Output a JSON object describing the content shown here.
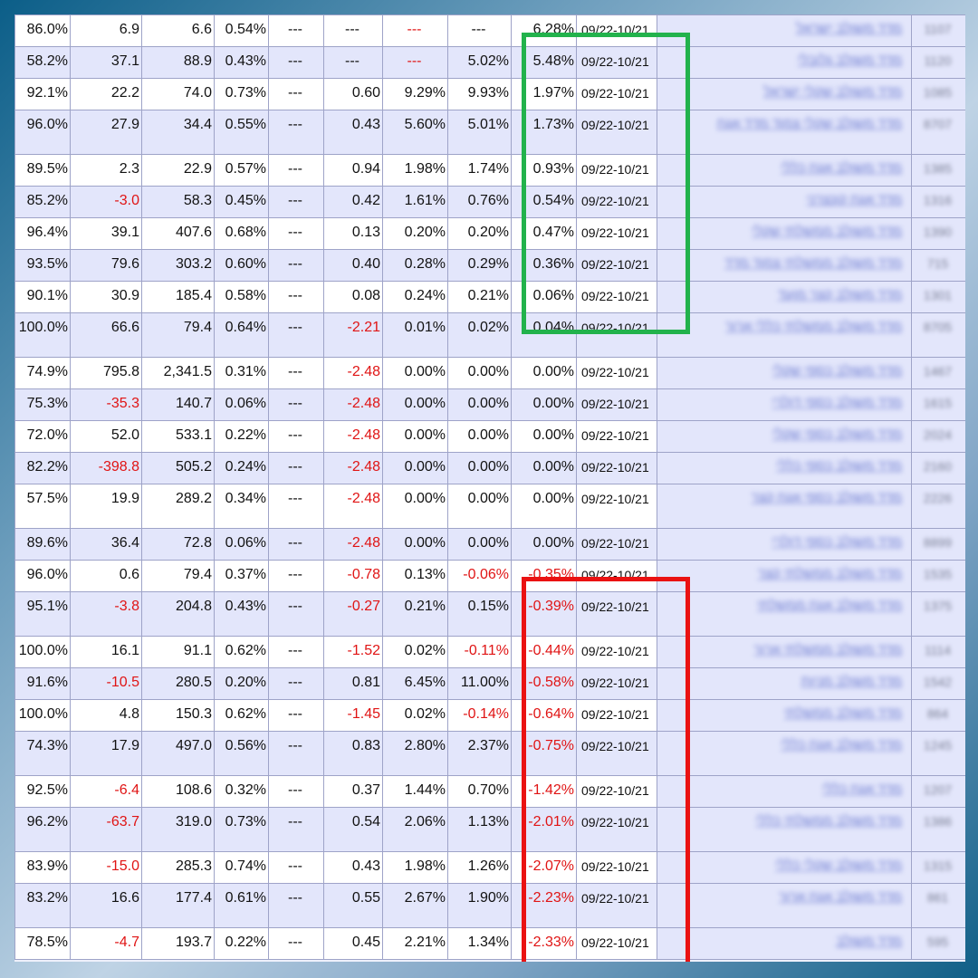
{
  "table": {
    "rows": [
      {
        "pct": "86.0%",
        "col2": "6.9",
        "col3": "6.6",
        "col4": "0.54%",
        "col5": "---",
        "col6": "---",
        "col7": "---",
        "col8": "---",
        "col9": "6.28%",
        "date": "09/22-10/21",
        "name": "מדד משולב ישראל",
        "id": "1107",
        "tall": false
      },
      {
        "pct": "58.2%",
        "col2": "37.1",
        "col3": "88.9",
        "col4": "0.43%",
        "col5": "---",
        "col6": "---",
        "col7": "---",
        "col8": "5.02%",
        "col9": "5.48%",
        "date": "09/22-10/21",
        "name": "מדד משולב גלובלי",
        "id": "1120",
        "tall": false
      },
      {
        "pct": "92.1%",
        "col2": "22.2",
        "col3": "74.0",
        "col4": "0.73%",
        "col5": "---",
        "col6": "0.60",
        "col7": "9.29%",
        "col8": "9.93%",
        "col9": "1.97%",
        "date": "09/22-10/21",
        "name": "מדד משולב שקלי ישראל",
        "id": "1085",
        "tall": false
      },
      {
        "pct": "96.0%",
        "col2": "27.9",
        "col3": "34.4",
        "col4": "0.55%",
        "col5": "---",
        "col6": "0.43",
        "col7": "5.60%",
        "col8": "5.01%",
        "col9": "1.73%",
        "date": "09/22-10/21",
        "name": "מדד משולב שקלי צמוד מדד אגח",
        "id": "8707",
        "tall": true
      },
      {
        "pct": "89.5%",
        "col2": "2.3",
        "col3": "22.9",
        "col4": "0.57%",
        "col5": "---",
        "col6": "0.94",
        "col7": "1.98%",
        "col8": "1.74%",
        "col9": "0.93%",
        "date": "09/22-10/21",
        "name": "מדד משולב אגח כללי",
        "id": "1385",
        "tall": false
      },
      {
        "pct": "85.2%",
        "col2": "-3.0",
        "col3": "58.3",
        "col4": "0.45%",
        "col5": "---",
        "col6": "0.42",
        "col7": "1.61%",
        "col8": "0.76%",
        "col9": "0.54%",
        "date": "09/22-10/21",
        "name": "מדד אגח קונצרני",
        "id": "1316",
        "tall": false
      },
      {
        "pct": "96.4%",
        "col2": "39.1",
        "col3": "407.6",
        "col4": "0.68%",
        "col5": "---",
        "col6": "0.13",
        "col7": "0.20%",
        "col8": "0.20%",
        "col9": "0.47%",
        "date": "09/22-10/21",
        "name": "מדד משולב ממשלתי שקלי",
        "id": "1390",
        "tall": false
      },
      {
        "pct": "93.5%",
        "col2": "79.6",
        "col3": "303.2",
        "col4": "0.60%",
        "col5": "---",
        "col6": "0.40",
        "col7": "0.28%",
        "col8": "0.29%",
        "col9": "0.36%",
        "date": "09/22-10/21",
        "name": "מדד משולב ממשלתי צמוד מדד",
        "id": "715",
        "tall": false
      },
      {
        "pct": "90.1%",
        "col2": "30.9",
        "col3": "185.4",
        "col4": "0.58%",
        "col5": "---",
        "col6": "0.08",
        "col7": "0.24%",
        "col8": "0.21%",
        "col9": "0.06%",
        "date": "09/22-10/21",
        "name": "מדד משולב קצר מועד",
        "id": "1301",
        "tall": false
      },
      {
        "pct": "100.0%",
        "col2": "66.6",
        "col3": "79.4",
        "col4": "0.64%",
        "col5": "---",
        "col6": "-2.21",
        "col7": "0.01%",
        "col8": "0.02%",
        "col9": "0.04%",
        "date": "09/22-10/21",
        "name": "מדד משולב ממשלתי כללי ארוך",
        "id": "8705",
        "tall": true
      },
      {
        "pct": "74.9%",
        "col2": "795.8",
        "col3": "2,341.5",
        "col4": "0.31%",
        "col5": "---",
        "col6": "-2.48",
        "col7": "0.00%",
        "col8": "0.00%",
        "col9": "0.00%",
        "date": "09/22-10/21",
        "name": "מדד משולב כספי שקלי",
        "id": "1467",
        "tall": false
      },
      {
        "pct": "75.3%",
        "col2": "-35.3",
        "col3": "140.7",
        "col4": "0.06%",
        "col5": "---",
        "col6": "-2.48",
        "col7": "0.00%",
        "col8": "0.00%",
        "col9": "0.00%",
        "date": "09/22-10/21",
        "name": "מדד משולב כספי דולרי",
        "id": "1615",
        "tall": false
      },
      {
        "pct": "72.0%",
        "col2": "52.0",
        "col3": "533.1",
        "col4": "0.22%",
        "col5": "---",
        "col6": "-2.48",
        "col7": "0.00%",
        "col8": "0.00%",
        "col9": "0.00%",
        "date": "09/22-10/21",
        "name": "מדד משולב כספי שקלי",
        "id": "2024",
        "tall": false
      },
      {
        "pct": "82.2%",
        "col2": "-398.8",
        "col3": "505.2",
        "col4": "0.24%",
        "col5": "---",
        "col6": "-2.48",
        "col7": "0.00%",
        "col8": "0.00%",
        "col9": "0.00%",
        "date": "09/22-10/21",
        "name": "מדד משולב כספי כללי",
        "id": "2160",
        "tall": false
      },
      {
        "pct": "57.5%",
        "col2": "19.9",
        "col3": "289.2",
        "col4": "0.34%",
        "col5": "---",
        "col6": "-2.48",
        "col7": "0.00%",
        "col8": "0.00%",
        "col9": "0.00%",
        "date": "09/22-10/21",
        "name": "מדד משולב כספי אגח קצר",
        "id": "2226",
        "tall": true
      },
      {
        "pct": "89.6%",
        "col2": "36.4",
        "col3": "72.8",
        "col4": "0.06%",
        "col5": "---",
        "col6": "-2.48",
        "col7": "0.00%",
        "col8": "0.00%",
        "col9": "0.00%",
        "date": "09/22-10/21",
        "name": "מדד משולב כספי דולרי",
        "id": "8899",
        "tall": false
      },
      {
        "pct": "96.0%",
        "col2": "0.6",
        "col3": "79.4",
        "col4": "0.37%",
        "col5": "---",
        "col6": "-0.78",
        "col7": "0.13%",
        "col8": "-0.06%",
        "col9": "-0.35%",
        "date": "09/22-10/21",
        "name": "מדד משולב ממשלתי קצר",
        "id": "1535",
        "tall": false
      },
      {
        "pct": "95.1%",
        "col2": "-3.8",
        "col3": "204.8",
        "col4": "0.43%",
        "col5": "---",
        "col6": "-0.27",
        "col7": "0.21%",
        "col8": "0.15%",
        "col9": "-0.39%",
        "date": "09/22-10/21",
        "name": "מדד משולב אגח ממשלתי",
        "id": "1375",
        "tall": true
      },
      {
        "pct": "100.0%",
        "col2": "16.1",
        "col3": "91.1",
        "col4": "0.62%",
        "col5": "---",
        "col6": "-1.52",
        "col7": "0.02%",
        "col8": "-0.11%",
        "col9": "-0.44%",
        "date": "09/22-10/21",
        "name": "מדד משולב ממשלתי ארוך",
        "id": "1114",
        "tall": false
      },
      {
        "pct": "91.6%",
        "col2": "-10.5",
        "col3": "280.5",
        "col4": "0.20%",
        "col5": "---",
        "col6": "0.81",
        "col7": "6.45%",
        "col8": "11.00%",
        "col9": "-0.58%",
        "date": "09/22-10/21",
        "name": "מדד משולב מניות",
        "id": "1542",
        "tall": false
      },
      {
        "pct": "100.0%",
        "col2": "4.8",
        "col3": "150.3",
        "col4": "0.62%",
        "col5": "---",
        "col6": "-1.45",
        "col7": "0.02%",
        "col8": "-0.14%",
        "col9": "-0.64%",
        "date": "09/22-10/21",
        "name": "מדד משולב ממשלתי",
        "id": "864",
        "tall": false
      },
      {
        "pct": "74.3%",
        "col2": "17.9",
        "col3": "497.0",
        "col4": "0.56%",
        "col5": "---",
        "col6": "0.83",
        "col7": "2.80%",
        "col8": "2.37%",
        "col9": "-0.75%",
        "date": "09/22-10/21",
        "name": "מדד משולב אגח כללי",
        "id": "1245",
        "tall": true
      },
      {
        "pct": "92.5%",
        "col2": "-6.4",
        "col3": "108.6",
        "col4": "0.32%",
        "col5": "---",
        "col6": "0.37",
        "col7": "1.44%",
        "col8": "0.70%",
        "col9": "-1.42%",
        "date": "09/22-10/21",
        "name": "מדד אגח כללי",
        "id": "1207",
        "tall": false
      },
      {
        "pct": "96.2%",
        "col2": "-63.7",
        "col3": "319.0",
        "col4": "0.73%",
        "col5": "---",
        "col6": "0.54",
        "col7": "2.06%",
        "col8": "1.13%",
        "col9": "-2.01%",
        "date": "09/22-10/21",
        "name": "מדד משולב ממשלתי כללי",
        "id": "1386",
        "tall": true
      },
      {
        "pct": "83.9%",
        "col2": "-15.0",
        "col3": "285.3",
        "col4": "0.74%",
        "col5": "---",
        "col6": "0.43",
        "col7": "1.98%",
        "col8": "1.26%",
        "col9": "-2.07%",
        "date": "09/22-10/21",
        "name": "מדד משולב שקלי כללי",
        "id": "1315",
        "tall": false
      },
      {
        "pct": "83.2%",
        "col2": "16.6",
        "col3": "177.4",
        "col4": "0.61%",
        "col5": "---",
        "col6": "0.55",
        "col7": "2.67%",
        "col8": "1.90%",
        "col9": "-2.23%",
        "date": "09/22-10/21",
        "name": "מדד משולב אגח ארוך",
        "id": "861",
        "tall": true
      },
      {
        "pct": "78.5%",
        "col2": "-4.7",
        "col3": "193.7",
        "col4": "0.22%",
        "col5": "---",
        "col6": "0.45",
        "col7": "2.21%",
        "col8": "1.34%",
        "col9": "-2.33%",
        "date": "09/22-10/21",
        "name": "מדד משולב",
        "id": "595",
        "tall": false
      }
    ]
  }
}
